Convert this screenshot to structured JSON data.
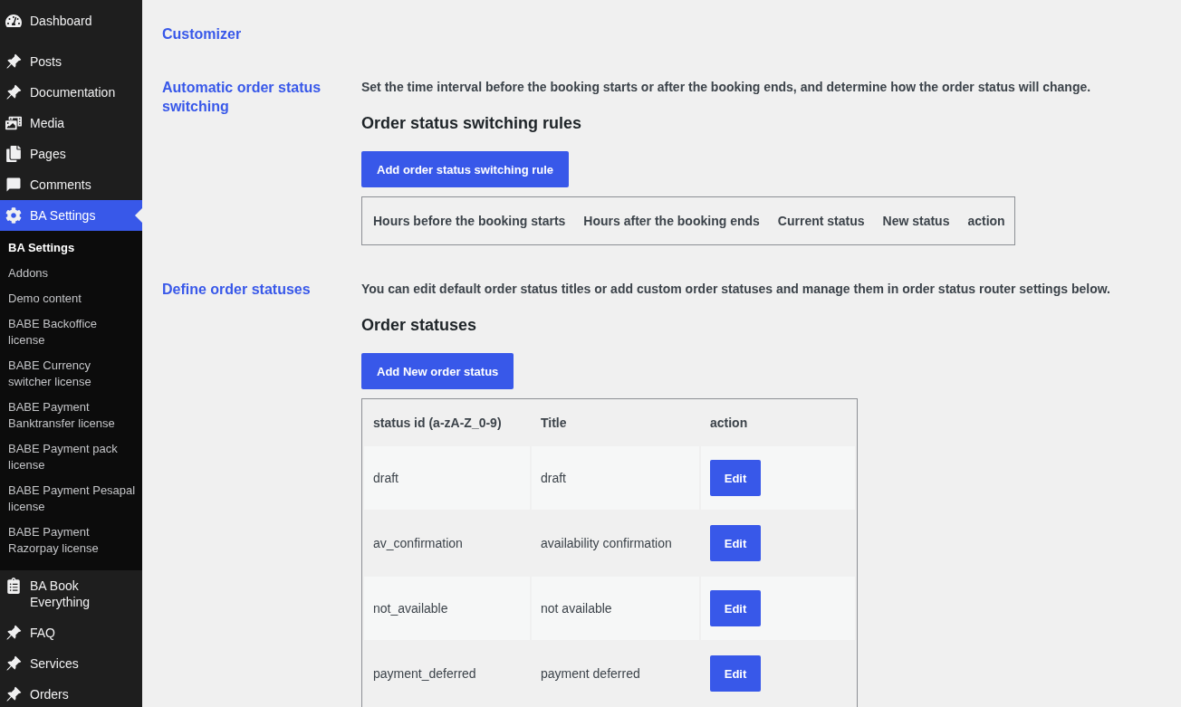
{
  "sidebar": {
    "items": [
      {
        "label": "Dashboard",
        "selected": false
      },
      {
        "label": "Posts",
        "selected": false
      },
      {
        "label": "Documentation",
        "selected": false
      },
      {
        "label": "Media",
        "selected": false
      },
      {
        "label": "Pages",
        "selected": false
      },
      {
        "label": "Comments",
        "selected": false
      },
      {
        "label": "BA Settings",
        "selected": true,
        "submenu": [
          {
            "label": "BA Settings",
            "selected": true
          },
          {
            "label": "Addons",
            "selected": false
          },
          {
            "label": "Demo content",
            "selected": false
          },
          {
            "label": "BABE Backoffice license",
            "selected": false
          },
          {
            "label": "BABE Currency switcher license",
            "selected": false
          },
          {
            "label": "BABE Payment Banktransfer license",
            "selected": false
          },
          {
            "label": "BABE Payment pack license",
            "selected": false
          },
          {
            "label": "BABE Payment Pesapal license",
            "selected": false
          },
          {
            "label": "BABE Payment Razorpay license",
            "selected": false
          }
        ]
      },
      {
        "label": "BA Book Everything",
        "selected": false
      },
      {
        "label": "FAQ",
        "selected": false
      },
      {
        "label": "Services",
        "selected": false
      },
      {
        "label": "Orders",
        "selected": false
      }
    ]
  },
  "sections": [
    {
      "title": "Customizer"
    },
    {
      "title": "Automatic order status switching",
      "description": "Set the time interval before the booking starts or after the booking ends, and determine how the order status will change.",
      "heading": "Order status switching rules",
      "button": "Add order status switching rule",
      "table": {
        "columns": [
          "Hours before the booking starts",
          "Hours after the booking ends",
          "Current status",
          "New status",
          "action"
        ]
      }
    },
    {
      "title": "Define order statuses",
      "description": "You can edit default order status titles or add custom order statuses and manage them in order status router settings below.",
      "heading": "Order statuses",
      "button": "Add New order status",
      "table": {
        "columns": [
          "status id (a-zA-Z_0-9)",
          "Title",
          "action"
        ],
        "rows": [
          {
            "cells": [
              "draft",
              "draft"
            ],
            "action": "Edit"
          },
          {
            "cells": [
              "av_confirmation",
              "availability confirmation"
            ],
            "action": "Edit"
          },
          {
            "cells": [
              "not_available",
              "not available"
            ],
            "action": "Edit"
          },
          {
            "cells": [
              "payment_deferred",
              "payment deferred"
            ],
            "action": "Edit"
          }
        ]
      }
    }
  ]
}
